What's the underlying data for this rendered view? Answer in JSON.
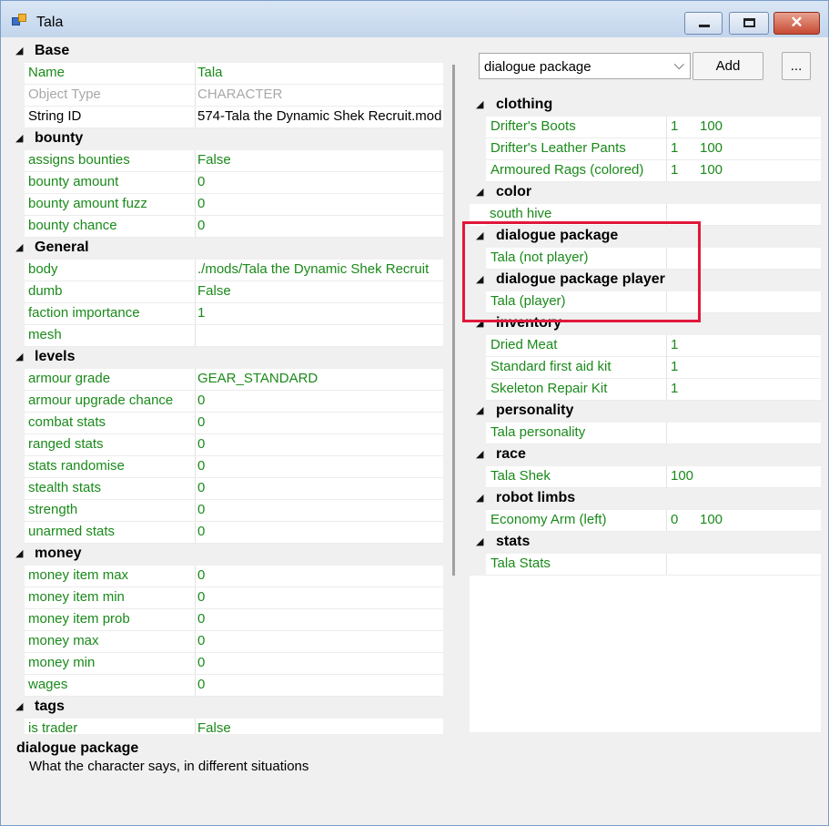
{
  "window": {
    "title": "Tala"
  },
  "left_grid": {
    "rows": [
      {
        "type": "cat",
        "label": "Base"
      },
      {
        "type": "prop",
        "name": "Name",
        "value": "Tala",
        "style": "green"
      },
      {
        "type": "prop",
        "name": "Object Type",
        "value": "CHARACTER",
        "style": "disabled"
      },
      {
        "type": "prop",
        "name": "String ID",
        "value": "574-Tala the Dynamic Shek Recruit.mod",
        "style": "black"
      },
      {
        "type": "cat",
        "label": "bounty"
      },
      {
        "type": "prop",
        "name": "assigns bounties",
        "value": "False",
        "style": "green"
      },
      {
        "type": "prop",
        "name": "bounty amount",
        "value": "0",
        "style": "green"
      },
      {
        "type": "prop",
        "name": "bounty amount fuzz",
        "value": "0",
        "style": "green"
      },
      {
        "type": "prop",
        "name": "bounty chance",
        "value": "0",
        "style": "green"
      },
      {
        "type": "cat",
        "label": "General"
      },
      {
        "type": "prop",
        "name": "body",
        "value": "./mods/Tala the Dynamic Shek Recruit",
        "style": "green"
      },
      {
        "type": "prop",
        "name": "dumb",
        "value": "False",
        "style": "green"
      },
      {
        "type": "prop",
        "name": "faction importance",
        "value": "1",
        "style": "green"
      },
      {
        "type": "prop",
        "name": "mesh",
        "value": "",
        "style": "green"
      },
      {
        "type": "cat",
        "label": "levels"
      },
      {
        "type": "prop",
        "name": "armour grade",
        "value": "GEAR_STANDARD",
        "style": "green"
      },
      {
        "type": "prop",
        "name": "armour upgrade chance",
        "value": "0",
        "style": "green"
      },
      {
        "type": "prop",
        "name": "combat stats",
        "value": "0",
        "style": "green"
      },
      {
        "type": "prop",
        "name": "ranged stats",
        "value": "0",
        "style": "green"
      },
      {
        "type": "prop",
        "name": "stats randomise",
        "value": "0",
        "style": "green"
      },
      {
        "type": "prop",
        "name": "stealth stats",
        "value": "0",
        "style": "green"
      },
      {
        "type": "prop",
        "name": "strength",
        "value": "0",
        "style": "green"
      },
      {
        "type": "prop",
        "name": "unarmed stats",
        "value": "0",
        "style": "green"
      },
      {
        "type": "cat",
        "label": "money"
      },
      {
        "type": "prop",
        "name": "money item max",
        "value": "0",
        "style": "green"
      },
      {
        "type": "prop",
        "name": "money item min",
        "value": "0",
        "style": "green"
      },
      {
        "type": "prop",
        "name": "money item prob",
        "value": "0",
        "style": "green"
      },
      {
        "type": "prop",
        "name": "money max",
        "value": "0",
        "style": "green"
      },
      {
        "type": "prop",
        "name": "money min",
        "value": "0",
        "style": "green"
      },
      {
        "type": "prop",
        "name": "wages",
        "value": "0",
        "style": "green"
      },
      {
        "type": "cat",
        "label": "tags"
      },
      {
        "type": "prop",
        "name": "is trader",
        "value": "False",
        "style": "green"
      }
    ]
  },
  "toolbar": {
    "reference_type": "dialogue package",
    "add_label": "Add",
    "more_label": "..."
  },
  "right_grid": {
    "rows": [
      {
        "type": "cat",
        "label": "clothing"
      },
      {
        "type": "item",
        "name": "Drifter's Boots",
        "v1": "1",
        "v2": "100"
      },
      {
        "type": "item",
        "name": "Drifter's Leather Pants",
        "v1": "1",
        "v2": "100"
      },
      {
        "type": "item",
        "name": "Armoured Rags (colored)",
        "v1": "1",
        "v2": "100"
      },
      {
        "type": "cat",
        "label": "color"
      },
      {
        "type": "item",
        "name": "south hive",
        "v1": "",
        "v2": "",
        "plain": true
      },
      {
        "type": "cat",
        "label": "dialogue package"
      },
      {
        "type": "item",
        "name": "Tala (not player)",
        "v1": "",
        "v2": ""
      },
      {
        "type": "cat",
        "label": "dialogue package player"
      },
      {
        "type": "item",
        "name": "Tala (player)",
        "v1": "",
        "v2": ""
      },
      {
        "type": "cat",
        "label": "inventory"
      },
      {
        "type": "item",
        "name": "Dried Meat",
        "v1": "1",
        "v2": ""
      },
      {
        "type": "item",
        "name": "Standard first aid kit",
        "v1": "1",
        "v2": ""
      },
      {
        "type": "item",
        "name": "Skeleton Repair Kit",
        "v1": "1",
        "v2": ""
      },
      {
        "type": "cat",
        "label": "personality"
      },
      {
        "type": "item",
        "name": "Tala personality",
        "v1": "",
        "v2": ""
      },
      {
        "type": "cat",
        "label": "race"
      },
      {
        "type": "item",
        "name": "Tala Shek",
        "v1": "100",
        "v2": ""
      },
      {
        "type": "cat",
        "label": "robot limbs"
      },
      {
        "type": "item",
        "name": "Economy Arm (left)",
        "v1": "0",
        "v2": "100"
      },
      {
        "type": "cat",
        "label": "stats"
      },
      {
        "type": "item",
        "name": "Tala Stats",
        "v1": "",
        "v2": ""
      }
    ]
  },
  "description": {
    "title": "dialogue package",
    "text": "What the character says, in different situations"
  },
  "colors": {
    "value_green": "#1a8a1a",
    "highlight": "#e0183a"
  }
}
